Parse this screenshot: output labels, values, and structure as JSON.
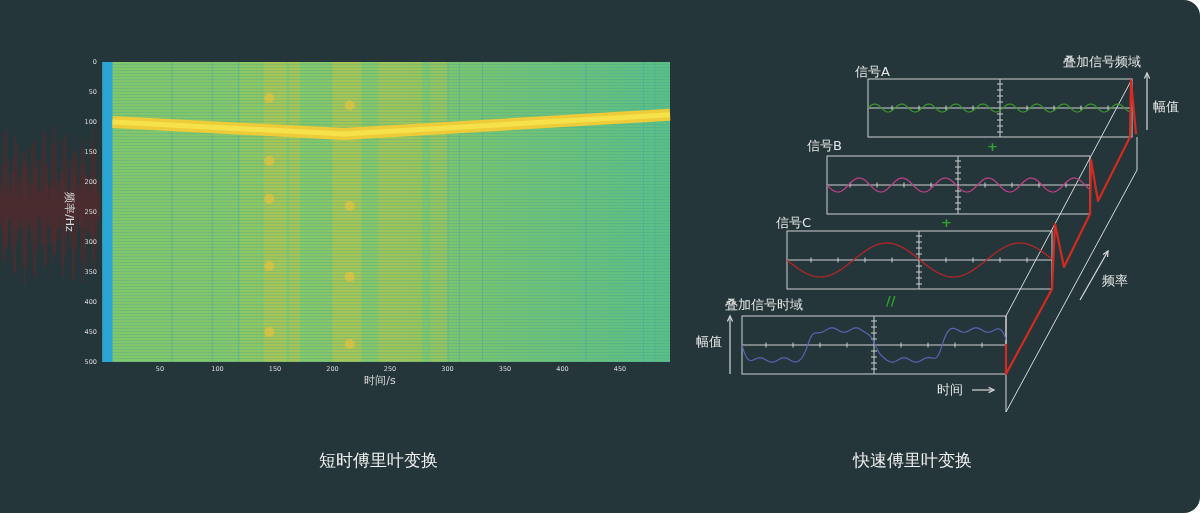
{
  "spectrogram": {
    "title": "短时傅里叶变换",
    "ylabel": "频率/Hz",
    "xlabel": "时间/s",
    "yticks": [
      "0",
      "50",
      "100",
      "150",
      "200",
      "250",
      "300",
      "350",
      "400",
      "450",
      "500"
    ],
    "xticks": [
      "50",
      "100",
      "150",
      "200",
      "250",
      "300",
      "350",
      "400",
      "450"
    ]
  },
  "fft_diagram": {
    "title": "快速傅里叶变换",
    "freq_domain_title": "叠加信号频域",
    "amplitude_axis_right": "幅值",
    "signals": [
      {
        "label": "信号A",
        "color": "#3a9a2c"
      },
      {
        "label": "信号B",
        "color": "#c0408a"
      },
      {
        "label": "信号C",
        "color": "#c42424"
      }
    ],
    "plus_signs": [
      "+",
      "+"
    ],
    "equals_sign": "//",
    "time_domain_title": "叠加信号时域",
    "amplitude_axis_left": "幅值",
    "time_axis": "时间",
    "frequency_axis": "频率"
  }
}
